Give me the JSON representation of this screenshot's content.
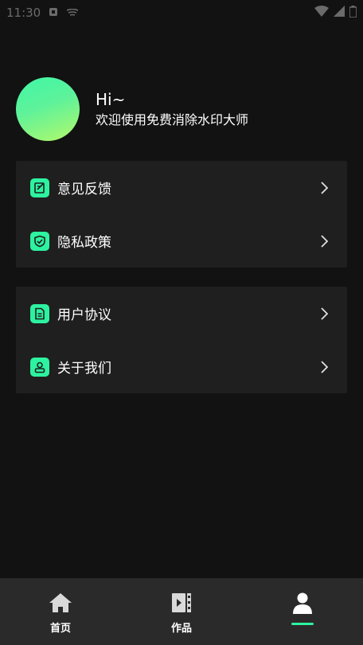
{
  "status_bar": {
    "time": "11:30",
    "icons": [
      "notification-icon",
      "cast-icon",
      "wifi-icon",
      "signal-icon",
      "battery-icon"
    ]
  },
  "profile": {
    "greeting": "Hi~",
    "subtitle": "欢迎使用免费消除水印大师"
  },
  "menu_group_1": [
    {
      "label": "意见反馈",
      "icon": "feedback-icon"
    },
    {
      "label": "隐私政策",
      "icon": "shield-icon"
    }
  ],
  "menu_group_2": [
    {
      "label": "用户协议",
      "icon": "document-icon"
    },
    {
      "label": "关于我们",
      "icon": "user-icon"
    }
  ],
  "tab_bar": {
    "tabs": [
      {
        "label": "首页",
        "icon": "home-icon"
      },
      {
        "label": "作品",
        "icon": "works-icon"
      },
      {
        "label": "",
        "icon": "profile-icon",
        "active": true
      }
    ]
  },
  "colors": {
    "background": "#121212",
    "card": "#1f1f1f",
    "accent": "#2df2a0",
    "tabbar": "#2a2a2a"
  }
}
